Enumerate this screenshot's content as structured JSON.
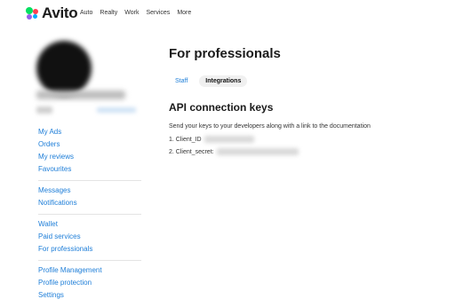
{
  "header": {
    "logo_text": "Avito",
    "nav": [
      "Auto",
      "Realty",
      "Work",
      "Services",
      "More"
    ]
  },
  "sidebar": {
    "groups": [
      [
        "My Ads",
        "Orders",
        "My reviews",
        "Favourites"
      ],
      [
        "Messages",
        "Notifications"
      ],
      [
        "Wallet",
        "Paid services",
        "For professionals"
      ],
      [
        "Profile Management",
        "Profile protection",
        "Settings"
      ]
    ]
  },
  "main": {
    "title": "For professionals",
    "tabs": [
      {
        "label": "Staff",
        "active": false
      },
      {
        "label": "Integrations",
        "active": true
      }
    ],
    "section_title": "API connection keys",
    "description": "Send your keys to your developers along with a link to the documentation",
    "keys": [
      {
        "label": "1. Client_ID"
      },
      {
        "label": "2. Client_secret:"
      }
    ]
  },
  "colors": {
    "link": "#1e7ed8",
    "logo_green": "#04e061",
    "logo_red": "#ff4053",
    "logo_purple": "#965eeb",
    "logo_blue": "#00aaff"
  }
}
